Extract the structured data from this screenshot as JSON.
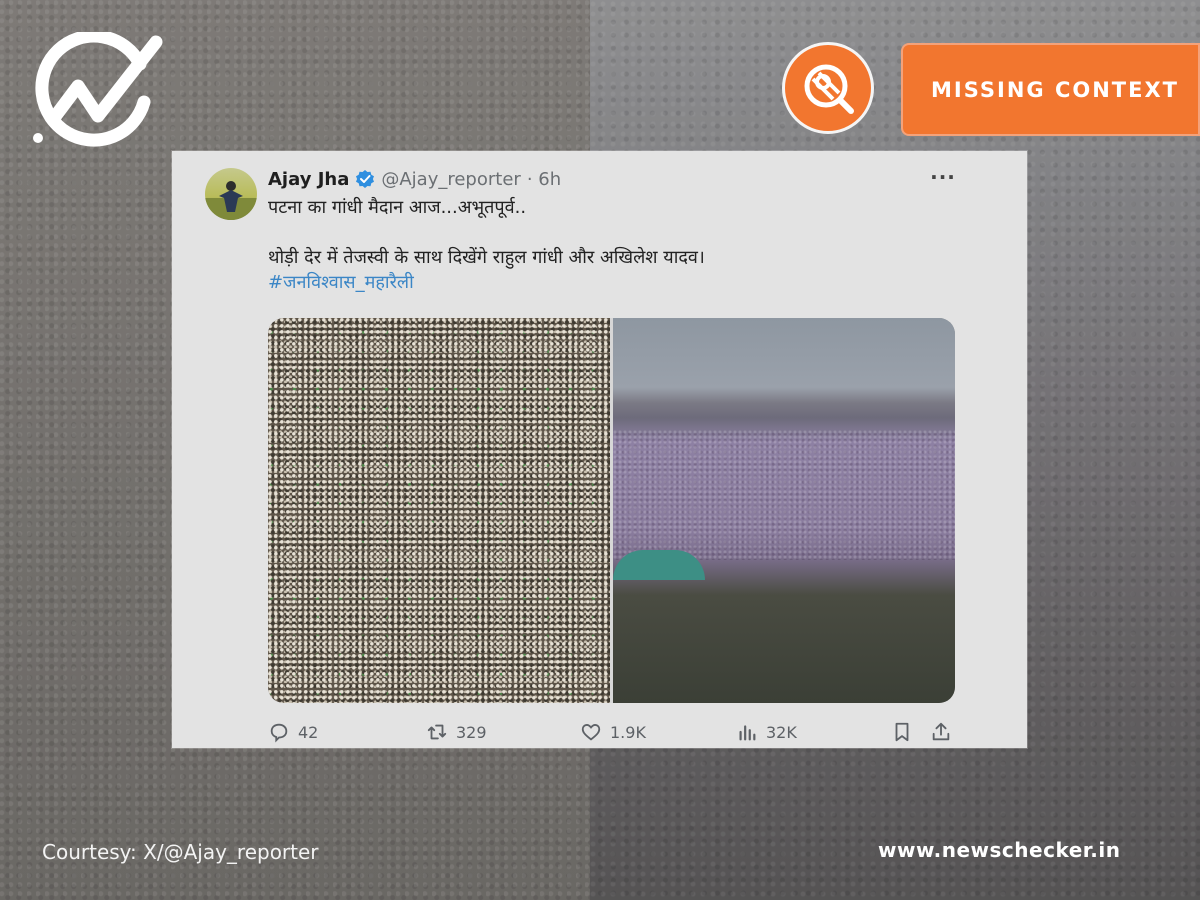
{
  "badge": {
    "label": "MISSING CONTEXT",
    "color": "#f2762f"
  },
  "tweet": {
    "author_name": "Ajay Jha",
    "handle": "@Ajay_reporter",
    "time": "· 6h",
    "line1": "पटना का गांधी मैदान आज...अभूतपूर्व..",
    "line2": "थोड़ी देर में तेजस्वी के साथ दिखेंगे राहुल गांधी और अखिलेश यादव।",
    "hashtag": "#जनविश्वास_महारैली",
    "more_icon": "···",
    "stats": {
      "replies": "42",
      "reposts": "329",
      "likes": "1.9K",
      "views": "32K"
    },
    "hashtag_color": "#3b86c6"
  },
  "footer": {
    "courtesy": "Courtesy: X/@Ajay_reporter",
    "site": "www.newschecker.in"
  },
  "icons": {
    "logo": "newschecker-logo-icon",
    "badge": "magnifier-badge-icon",
    "verified": "verified-check-icon",
    "reply": "reply-icon",
    "repost": "repost-icon",
    "like": "heart-icon",
    "views": "views-chart-icon",
    "bookmark": "bookmark-icon",
    "share": "share-icon"
  }
}
